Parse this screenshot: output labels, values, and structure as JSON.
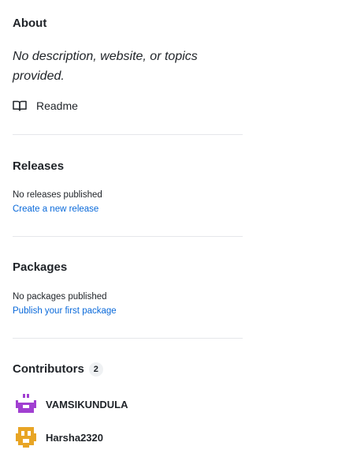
{
  "about": {
    "title": "About",
    "description": "No description, website, or topics provided.",
    "readme_label": "Readme"
  },
  "releases": {
    "title": "Releases",
    "empty_text": "No releases published",
    "create_link": "Create a new release"
  },
  "packages": {
    "title": "Packages",
    "empty_text": "No packages published",
    "publish_link": "Publish your first package"
  },
  "contributors": {
    "title": "Contributors",
    "count": "2",
    "list": [
      {
        "name": "VAMSIKUNDULA",
        "avatar_color": "#a13fd1"
      },
      {
        "name": "Harsha2320",
        "avatar_color": "#e8a525"
      }
    ]
  },
  "colors": {
    "link": "#0969da",
    "text": "#1f2328",
    "divider": "#e5e7ea"
  }
}
